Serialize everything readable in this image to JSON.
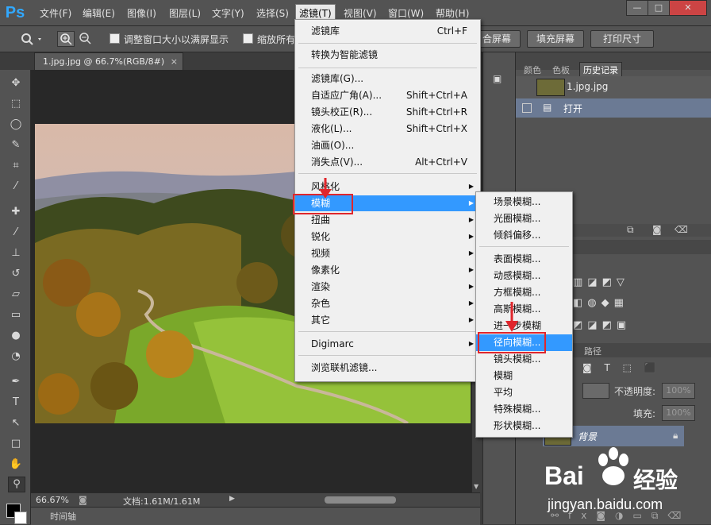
{
  "menubar": {
    "logo": "Ps",
    "items": [
      "文件(F)",
      "编辑(E)",
      "图像(I)",
      "图层(L)",
      "文字(Y)",
      "选择(S)",
      "滤镜(T)",
      "视图(V)",
      "窗口(W)",
      "帮助(H)"
    ],
    "window_buttons": [
      "—",
      "□",
      "✕"
    ]
  },
  "options_bar": {
    "resize_windows_label": "调整窗口大小以满屏显示",
    "zoom_all_label": "缩放所有",
    "fit_screen": "合屏幕",
    "fill_screen": "填充屏幕",
    "print_size": "打印尺寸"
  },
  "document": {
    "tab_title": "1.jpg.jpg @ 66.7%(RGB/8#)",
    "zoom": "66.67%",
    "doc_info": "文档:1.61M/1.61M",
    "timeline": "时间轴"
  },
  "panels": {
    "tabs": [
      "颜色",
      "色板",
      "历史记录"
    ],
    "history_snapshot": "1.jpg.jpg",
    "history_item": "打开",
    "layers_tab": "路径",
    "opacity_label": "不透明度:",
    "opacity_value": "100%",
    "fill_label": "填充:",
    "fill_value": "100%",
    "background_layer": "背景"
  },
  "filter_menu": {
    "items": [
      {
        "label": "滤镜库",
        "shortcut": "Ctrl+F"
      },
      {
        "label": "转换为智能滤镜",
        "shortcut": ""
      },
      {
        "label": "滤镜库(G)...",
        "shortcut": ""
      },
      {
        "label": "自适应广角(A)...",
        "shortcut": "Shift+Ctrl+A"
      },
      {
        "label": "镜头校正(R)...",
        "shortcut": "Shift+Ctrl+R"
      },
      {
        "label": "液化(L)...",
        "shortcut": "Shift+Ctrl+X"
      },
      {
        "label": "油画(O)...",
        "shortcut": ""
      },
      {
        "label": "消失点(V)...",
        "shortcut": "Alt+Ctrl+V"
      },
      {
        "label": "风格化",
        "shortcut": ""
      },
      {
        "label": "模糊",
        "shortcut": ""
      },
      {
        "label": "扭曲",
        "shortcut": ""
      },
      {
        "label": "锐化",
        "shortcut": ""
      },
      {
        "label": "视频",
        "shortcut": ""
      },
      {
        "label": "像素化",
        "shortcut": ""
      },
      {
        "label": "渲染",
        "shortcut": ""
      },
      {
        "label": "杂色",
        "shortcut": ""
      },
      {
        "label": "其它",
        "shortcut": ""
      },
      {
        "label": "Digimarc",
        "shortcut": ""
      },
      {
        "label": "浏览联机滤镜...",
        "shortcut": ""
      }
    ]
  },
  "blur_submenu": {
    "items": [
      "场景模糊...",
      "光圈模糊...",
      "倾斜偏移...",
      "表面模糊...",
      "动感模糊...",
      "方框模糊...",
      "高斯模糊...",
      "进一步模糊",
      "径向模糊...",
      "镜头模糊...",
      "模糊",
      "平均",
      "特殊模糊...",
      "形状模糊..."
    ]
  },
  "watermark": {
    "brand": "Bai",
    "brand_cn": "经验",
    "url": "jingyan.baidu.com"
  },
  "colors": {
    "highlight": "#3399ff",
    "annotation_red": "#e0262c",
    "menu_bg": "#f0f0f0",
    "chrome": "#535353"
  }
}
